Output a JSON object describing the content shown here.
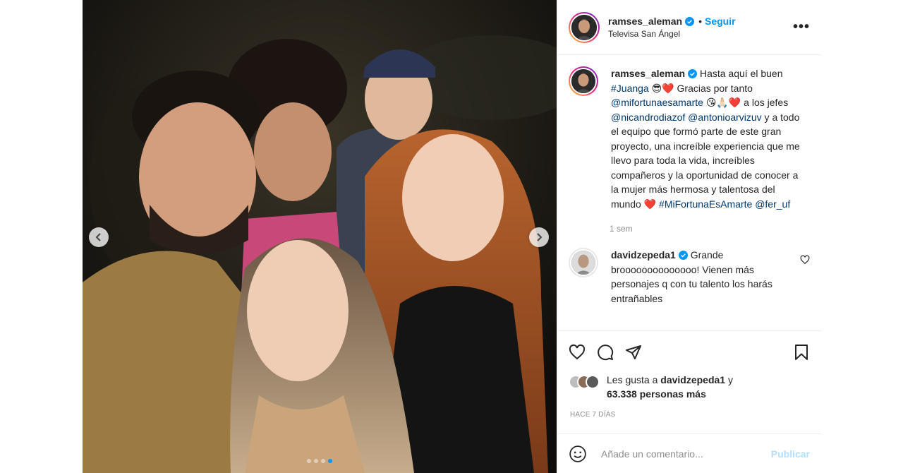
{
  "post": {
    "username": "ramses_aleman",
    "location": "Televisa San Ángel",
    "follow_label": "Seguir",
    "separator": "•",
    "more_label": "•••"
  },
  "caption": {
    "username": "ramses_aleman",
    "parts": [
      {
        "t": "Hasta aquí el buen "
      },
      {
        "t": "#Juanga",
        "tag": true
      },
      {
        "t": " 😎❤️ Gracias por tanto "
      },
      {
        "t": "@mifortunaesamarte",
        "tag": true
      },
      {
        "t": " 😘🙏🏻❤️ a los jefes "
      },
      {
        "t": "@nicandrodiazof",
        "tag": true
      },
      {
        "t": " "
      },
      {
        "t": "@antonioarvizuv",
        "tag": true
      },
      {
        "t": " y a todo el equipo que formó parte de este gran proyecto, una increíble experiencia que me llevo para toda la vida, increíbles compañeros y la oportunidad de conocer a la mujer más hermosa y talentosa del mundo ❤️ "
      },
      {
        "t": "#MiFortunaEsAmarte",
        "tag": true
      },
      {
        "t": " "
      },
      {
        "t": "@fer_uf",
        "tag": true
      }
    ],
    "age": "1 sem"
  },
  "comment": {
    "username": "davidzepeda1",
    "text": "Grande broooooooooooooo! Vienen más personajes q con tu talento los harás entrañables"
  },
  "likes": {
    "prefix": "Les gusta a ",
    "user": "davidzepeda1",
    "middle": " y",
    "count": "63.338 personas más"
  },
  "timestamp": "HACE 7 DÍAS",
  "add_comment": {
    "placeholder": "Añade un comentario...",
    "publish": "Publicar"
  },
  "carousel": {
    "count": 4,
    "active": 3
  },
  "icons": [
    "verified-badge-icon",
    "more-options-icon",
    "heart-icon",
    "comment-icon",
    "share-icon",
    "bookmark-icon",
    "emoji-icon",
    "chevron-left-icon",
    "chevron-right-icon"
  ],
  "colors": {
    "accent": "#0095f6",
    "tag": "#00376b",
    "muted": "#8e8e8e",
    "publish_disabled": "#b2dffc",
    "heart": "#ed4956"
  }
}
